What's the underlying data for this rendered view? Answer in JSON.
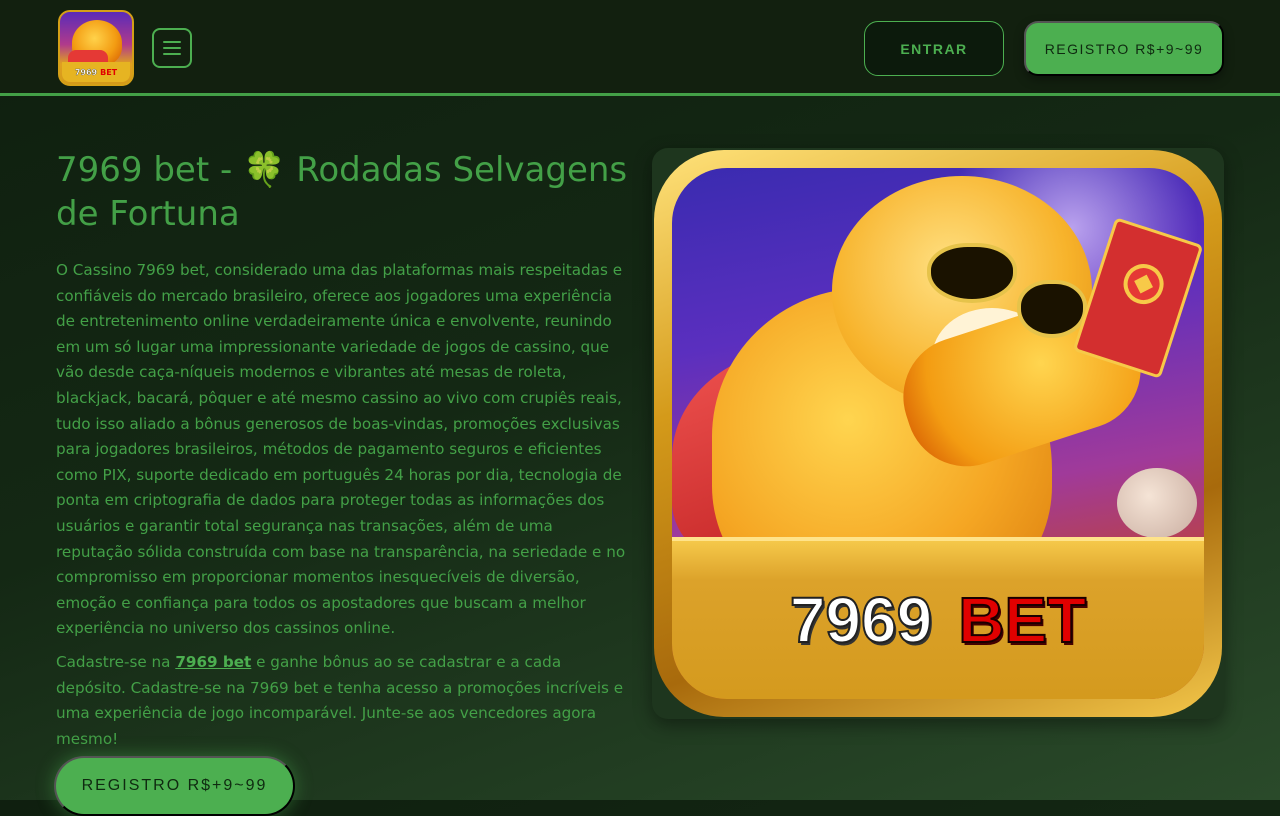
{
  "header": {
    "logo": {
      "icon": "7969-bet-tiger-logo-icon",
      "text_number": "7969",
      "text_brand": "BET"
    },
    "menu_icon": "hamburger-menu-icon",
    "entrar_label": "ENTRAR",
    "registro_label": "REGISTRO R$+9~99"
  },
  "main": {
    "title_prefix": "7969 bet -",
    "title_clover": "🍀",
    "title_suffix": "Rodadas Selvagens de Fortuna",
    "intro": "O Cassino 7969 bet, considerado uma das plataformas mais respeitadas e confiáveis do mercado brasileiro, oferece aos jogadores uma experiência de entretenimento online verdadeiramente única e envolvente, reunindo em um só lugar uma impressionante variedade de jogos de cassino, que vão desde caça-níqueis modernos e vibrantes até mesas de roleta, blackjack, bacará, pôquer e até mesmo cassino ao vivo com crupiês reais, tudo isso aliado a bônus generosos de boas-vindas, promoções exclusivas para jogadores brasileiros, métodos de pagamento seguros e eficientes como PIX, suporte dedicado em português 24 horas por dia, tecnologia de ponta em criptografia de dados para proteger todas as informações dos usuários e garantir total segurança nas transações, além de uma reputação sólida construída com base na transparência, na seriedade e no compromisso em proporcionar momentos inesquecíveis de diversão, emoção e confiança para todos os apostadores que buscam a melhor experiência no universo dos cassinos online.",
    "signup_before": "Cadastre-se na ",
    "signup_link": "7969 bet",
    "signup_after": " e ganhe bônus ao se cadastrar e a cada depósito. Cadastre-se na 7969 bet e tenha acesso a promoções incríveis e uma experiência de jogo incomparável. Junte-se aos vencedores agora mesmo!",
    "registro_label": "REGISTRO R$+9~99"
  },
  "hero": {
    "icon": "fortune-tiger-game-icon",
    "text_number": "7969",
    "text_brand": "BET"
  },
  "colors": {
    "accent_green": "#4caf50",
    "header_bg": "#12200f",
    "brand_red": "#e00000",
    "gold": "#d49a1e"
  }
}
